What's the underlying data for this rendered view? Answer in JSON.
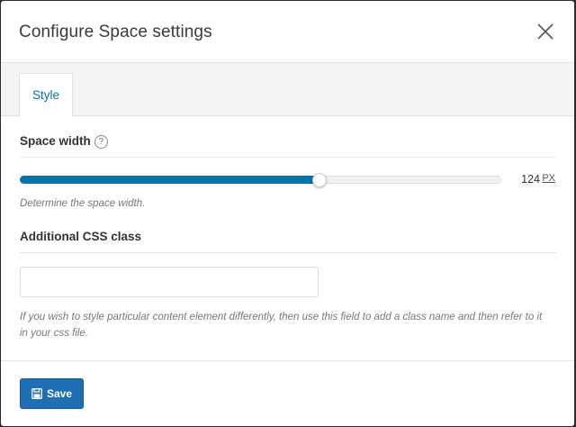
{
  "modal": {
    "title": "Configure Space settings"
  },
  "tabs": [
    {
      "label": "Style",
      "active": true
    }
  ],
  "space_width": {
    "label": "Space width",
    "help_icon_glyph": "?",
    "value": "124",
    "unit": "PX",
    "slider_fraction": 0.62,
    "description": "Determine the space width."
  },
  "css_class": {
    "label": "Additional CSS class",
    "value": "",
    "placeholder": "",
    "description": "If you wish to style particular content element differently, then use this field to add a class name and then refer to it in your css file."
  },
  "footer": {
    "save_label": "Save"
  },
  "colors": {
    "accent": "#0073aa",
    "button": "#1e6fb3"
  },
  "icons": {
    "close": "close-icon",
    "help": "question-circle-icon",
    "save": "floppy-disk-icon"
  }
}
